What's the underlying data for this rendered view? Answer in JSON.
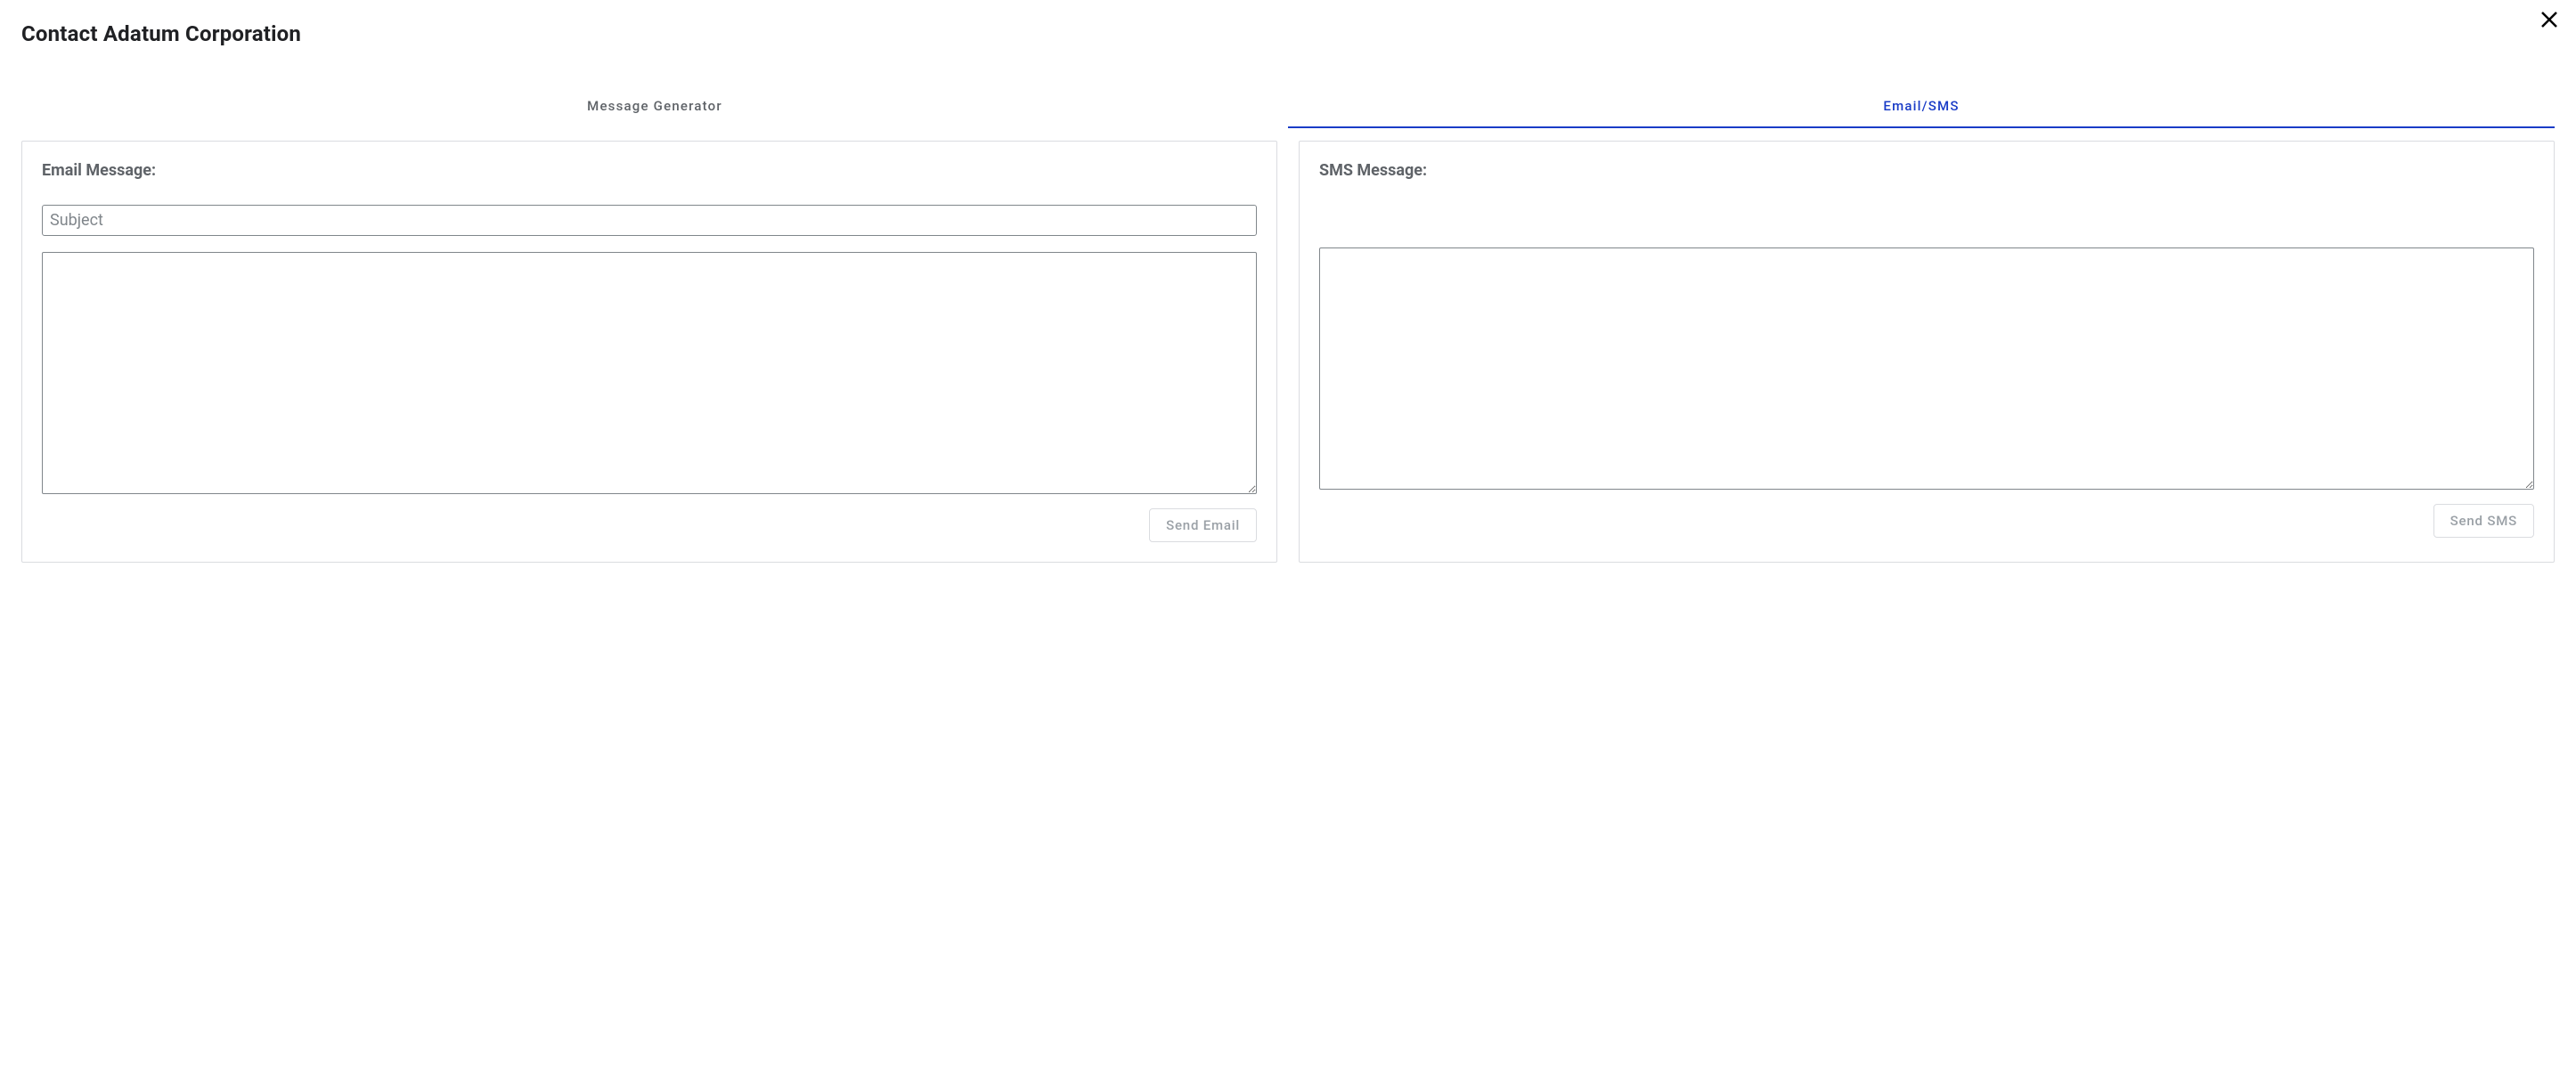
{
  "header": {
    "title": "Contact Adatum Corporation"
  },
  "tabs": {
    "message_generator": "Message Generator",
    "email_sms": "Email/SMS"
  },
  "email_panel": {
    "label": "Email Message:",
    "subject_placeholder": "Subject",
    "subject_value": "",
    "body_value": "",
    "send_label": "Send Email"
  },
  "sms_panel": {
    "label": "SMS Message:",
    "body_value": "",
    "send_label": "Send SMS"
  }
}
